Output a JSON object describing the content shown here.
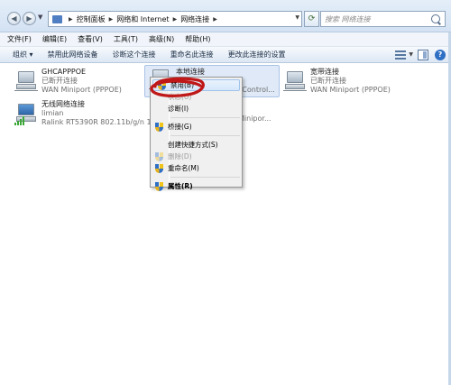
{
  "address_bar": {
    "crumbs": [
      "控制面板",
      "网络和 Internet",
      "网络连接"
    ],
    "search_placeholder": "搜索 网络连接"
  },
  "menu": [
    "文件(F)",
    "编辑(E)",
    "查看(V)",
    "工具(T)",
    "高级(N)",
    "帮助(H)"
  ],
  "commands": [
    "组织 ▾",
    "禁用此网络设备",
    "诊断这个连接",
    "重命名此连接",
    "更改此连接的设置"
  ],
  "connections": [
    {
      "name": "GHCAPPPOE",
      "status": "已断开连接",
      "device": "WAN Miniport (PPPOE)"
    },
    {
      "name": "本地连接",
      "status": "",
      "device": "y Control..."
    },
    {
      "name": "宽带连接",
      "status": "已断开连接",
      "device": "WAN Miniport (PPPOE)"
    },
    {
      "name": "无线网络连接",
      "status": "limian",
      "device": "Ralink RT5390R 802.11b/g/n 1..."
    }
  ],
  "partial_device_text": "Minipor...",
  "context_menu": [
    {
      "label": "禁用(B)",
      "icon": "shield-icon",
      "highlighted": true
    },
    {
      "label": "状态(U)",
      "disabled": true
    },
    {
      "label": "诊断(I)"
    },
    {
      "separator": true
    },
    {
      "label": "桥接(G)",
      "icon": "shield-icon"
    },
    {
      "separator": true
    },
    {
      "label": "创建快捷方式(S)"
    },
    {
      "label": "删除(D)",
      "icon": "shield-icon",
      "disabled": true
    },
    {
      "label": "重命名(M)",
      "icon": "shield-icon"
    },
    {
      "separator": true
    },
    {
      "label": "属性(R)",
      "icon": "shield-icon",
      "bold": true
    }
  ],
  "colors": {
    "chrome": "#d3e2f3",
    "selection": "#dfe9f7",
    "annotation_red": "#c01818",
    "wifi_green": "#3aa835"
  }
}
